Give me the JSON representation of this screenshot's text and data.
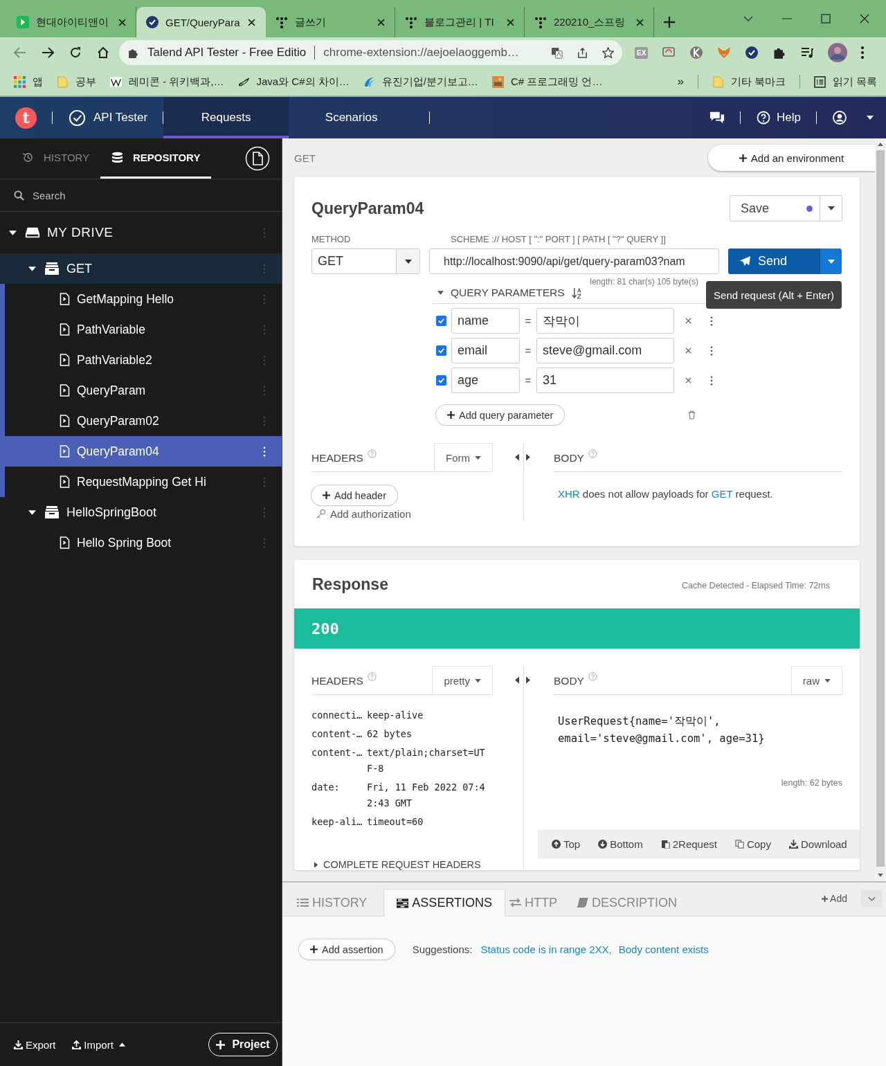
{
  "browser": {
    "tabs": [
      {
        "title": "현대아이티앤이",
        "selected": false,
        "kind": "green"
      },
      {
        "title": "GET/QueryPara",
        "selected": true,
        "kind": "check"
      },
      {
        "title": "글쓰기",
        "selected": false,
        "kind": "dots"
      },
      {
        "title": "블로그관리 | TI",
        "selected": false,
        "kind": "dots"
      },
      {
        "title": "220210_스프링",
        "selected": false,
        "kind": "dots"
      }
    ],
    "address": {
      "site": "Talend API Tester - Free Editio",
      "url": "chrome-extension://aejoelaoggemb…"
    },
    "extension_badge": "EX",
    "bookmarks": [
      {
        "title": "앱",
        "kind": "apps"
      },
      {
        "title": "공부",
        "kind": "folder"
      },
      {
        "title": "레미콘 - 위키백과,…",
        "kind": "wiki"
      },
      {
        "title": "Java와 C#의 차이…",
        "kind": "wing"
      },
      {
        "title": "유진기업/분기보고…",
        "kind": "swirl"
      },
      {
        "title": "C# 프로그래밍 언…",
        "kind": "image"
      }
    ],
    "bookmark_overflow": "»",
    "other_bookmarks": "기타 북마크",
    "reading_list": "읽기 목록"
  },
  "app": {
    "logo": "t",
    "product": "API Tester",
    "nav": [
      {
        "label": "Requests",
        "selected": true
      },
      {
        "label": "Scenarios",
        "selected": false
      }
    ],
    "help": "Help"
  },
  "sidebar": {
    "tabs": [
      {
        "label": "HISTORY",
        "selected": false,
        "kind": "history"
      },
      {
        "label": "REPOSITORY",
        "selected": true,
        "kind": "repository"
      }
    ],
    "search": {
      "placeholder": "Search"
    },
    "tree": [
      {
        "label": "MY DRIVE",
        "kind": "drive",
        "expanded": true,
        "children": [
          {
            "label": "GET",
            "kind": "service",
            "expanded": true,
            "children": [
              {
                "label": "GetMapping Hello",
                "kind": "request",
                "selected": false
              },
              {
                "label": "PathVariable",
                "kind": "request",
                "selected": false
              },
              {
                "label": "PathVariable2",
                "kind": "request",
                "selected": false
              },
              {
                "label": "QueryParam",
                "kind": "request",
                "selected": false
              },
              {
                "label": "QueryParam02",
                "kind": "request",
                "selected": false
              },
              {
                "label": "QueryParam04",
                "kind": "request",
                "selected": true
              },
              {
                "label": "RequestMapping Get Hi",
                "kind": "request",
                "selected": false
              }
            ]
          },
          {
            "label": "HelloSpringBoot",
            "kind": "service",
            "expanded": true,
            "children": [
              {
                "label": "Hello Spring Boot",
                "kind": "request",
                "selected": false
              }
            ]
          }
        ]
      }
    ],
    "footer": {
      "export": "Export",
      "import": "Import",
      "project": "Project"
    }
  },
  "request": {
    "breadcrumb": "GET",
    "add_environment": "Add an environment",
    "title": "QueryParam04",
    "save": "Save",
    "unsaved": true,
    "method_label": "METHOD",
    "method": "GET",
    "url_label": "SCHEME :// HOST [ \":\" PORT ] [ PATH [ \"?\" QUERY ]]",
    "url": "http://localhost:9090/api/get/query-param03?nam",
    "length": "length: 81 char(s) 105 byte(s)",
    "send": "Send",
    "tooltip": "Send request (Alt + Enter)",
    "query_title": "QUERY PARAMETERS",
    "query_expanded": true,
    "params": [
      {
        "checked": true,
        "name": "name",
        "operator": "=",
        "value": "작막이"
      },
      {
        "checked": true,
        "name": "email",
        "operator": "=",
        "value": "steve@gmail.com"
      },
      {
        "checked": true,
        "name": "age",
        "operator": "=",
        "value": "31"
      }
    ],
    "add_param": "Add query parameter",
    "headers_title": "HEADERS",
    "headers_mode": "Form",
    "add_header": "Add header",
    "add_authorization": "Add authorization",
    "body_title": "BODY",
    "body_note": [
      {
        "text": "XHR",
        "kind": "link"
      },
      {
        "text": " does not allow payloads for ",
        "kind": "plain"
      },
      {
        "text": "GET",
        "kind": "link"
      },
      {
        "text": " request.",
        "kind": "plain"
      }
    ]
  },
  "response": {
    "title": "Response",
    "meta": "Cache Detected - Elapsed Time: 72ms",
    "status": "200",
    "headers_title": "HEADERS",
    "headers_mode": "pretty",
    "headers": [
      {
        "key": "connecti…",
        "value": "keep-alive"
      },
      {
        "key": "content-…",
        "value": "62 bytes"
      },
      {
        "key": "content-…",
        "value": "text/plain;charset=UTF-8"
      },
      {
        "key": "date:",
        "value": "Fri, 11 Feb 2022 07:42:43 GMT"
      },
      {
        "key": "keep-ali…",
        "value": "timeout=60"
      }
    ],
    "complete_headers": "COMPLETE REQUEST HEADERS",
    "body_title": "BODY",
    "body_mode": "raw",
    "body": "UserRequest{name='작막이', email='steve@gmail.com', age=31}",
    "body_length": "length: 62 bytes",
    "actions": [
      {
        "label": "Top",
        "kind": "up"
      },
      {
        "label": "Bottom",
        "kind": "down"
      },
      {
        "label": "2Request",
        "kind": "paste"
      },
      {
        "label": "Copy",
        "kind": "copy"
      },
      {
        "label": "Download",
        "kind": "download"
      }
    ]
  },
  "bottom": {
    "tabs": [
      {
        "label": "HISTORY",
        "selected": false,
        "kind": "list"
      },
      {
        "label": "ASSERTIONS",
        "selected": true,
        "kind": "assert"
      },
      {
        "label": "HTTP",
        "selected": false,
        "kind": "swap"
      },
      {
        "label": "DESCRIPTION",
        "selected": false,
        "kind": "book"
      }
    ],
    "add": "Add",
    "add_assertion": "Add assertion",
    "suggestions_label": "Suggestions:",
    "suggestions": [
      "Status code is in range 2XX,",
      "Body content exists"
    ]
  }
}
